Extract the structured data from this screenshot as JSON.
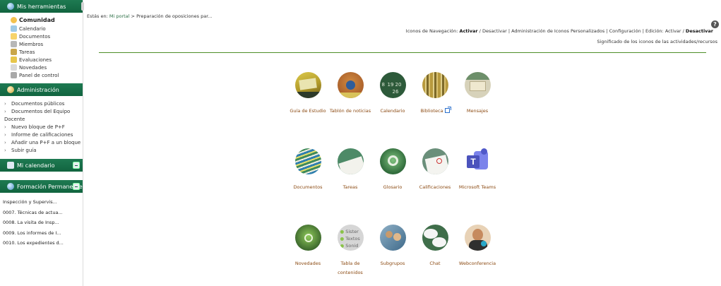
{
  "sidebar": {
    "tools_header": "Mis herramientas",
    "tools": [
      {
        "label": "Comunidad",
        "icon": "community-icon",
        "color": "#f3c24f"
      },
      {
        "label": "Calendario",
        "icon": "calendar-icon",
        "color": "#9ecae6"
      },
      {
        "label": "Documentos",
        "icon": "documents-icon",
        "color": "#f6d36b"
      },
      {
        "label": "Miembros",
        "icon": "members-icon",
        "color": "#b7b7b7"
      },
      {
        "label": "Tareas",
        "icon": "tasks-icon",
        "color": "#c9a64a"
      },
      {
        "label": "Evaluaciones",
        "icon": "evaluations-icon",
        "color": "#e7c64b"
      },
      {
        "label": "Novedades",
        "icon": "news-icon",
        "color": "#d9d9d9"
      },
      {
        "label": "Panel de control",
        "icon": "control-panel-icon",
        "color": "#a9a9a9"
      }
    ],
    "admin_header": "Administración",
    "admin_items": [
      "Documentos públicos",
      "Documentos del Equipo",
      "Nuevo bloque de P+F",
      "Informe de calificaciones",
      "Añadir una P+F a un bloque",
      "Subir guía"
    ],
    "admin_item_cont": "Docente",
    "calendar_header": "Mi calendario",
    "fp_header": "Formación Permanente",
    "fp_items": [
      "Inspección y Supervis...",
      "0007. Técnicas de actua...",
      "0008. La visita de Insp...",
      "0009. Los informes de I...",
      "0010. Los expedientes d..."
    ]
  },
  "breadcrumb": {
    "prefix": "Estás en:",
    "link": "Mi portal",
    "separator": ">",
    "current": "Preparación de oposiciones par..."
  },
  "nav_icons": {
    "label": "Iconos de Navegación:",
    "activar": "Activar",
    "desactivar": "Desactivar",
    "admin": "Administración de Iconos Personalizados",
    "config": "Configuración",
    "edicion_label": "Edición:",
    "edicion_activar": "Activar",
    "edicion_desactivar": "Desactivar",
    "help": "?"
  },
  "meaning_link": "Significado de los iconos de las actividades/recursos",
  "tiles": [
    {
      "label": "Guía de Estudio",
      "icon": "study-guide-icon",
      "bg": "#c9b33a"
    },
    {
      "label": "Tablón de noticias",
      "icon": "bulletin-board-icon",
      "bg": "#b86a32"
    },
    {
      "label": "Calendario",
      "icon": "calendar-icon",
      "bg": "#2d5a3a"
    },
    {
      "label": "Biblioteca",
      "icon": "library-icon",
      "bg": "#a88a3a",
      "external": true
    },
    {
      "label": "Mensajes",
      "icon": "messages-icon",
      "bg": "#c9c2a6"
    },
    {
      "label": "Documentos",
      "icon": "documents-icon",
      "bg": "#3f7f55"
    },
    {
      "label": "Tareas",
      "icon": "tasks-icon",
      "bg": "#4d8a67"
    },
    {
      "label": "Glosario",
      "icon": "glossary-icon",
      "bg": "#2f6a3a"
    },
    {
      "label": "Calificaciones",
      "icon": "grades-icon",
      "bg": "#6a8f7a"
    },
    {
      "label": "Microsoft Teams",
      "icon": "teams-icon",
      "bg": "#4b53bc"
    },
    {
      "label": "Novedades",
      "icon": "news-icon",
      "bg": "#3e6a2e"
    },
    {
      "label": "Tabla de contenidos",
      "icon": "contents-table-icon",
      "bg": "#bdbdbd",
      "lines": [
        "Sister",
        "Textos",
        "Sonid"
      ]
    },
    {
      "label": "Subgrupos",
      "icon": "subgroups-icon",
      "bg": "#5c8aa8"
    },
    {
      "label": "Chat",
      "icon": "chat-icon",
      "bg": "#3f6e4a"
    },
    {
      "label": "Webconferencia",
      "icon": "webconference-icon",
      "bg": "#d9a97a"
    }
  ],
  "calendar_numbers": [
    "8",
    "19",
    "20",
    "26"
  ],
  "accent": "#4e8f29",
  "sidebar_header_color": "#11643f"
}
